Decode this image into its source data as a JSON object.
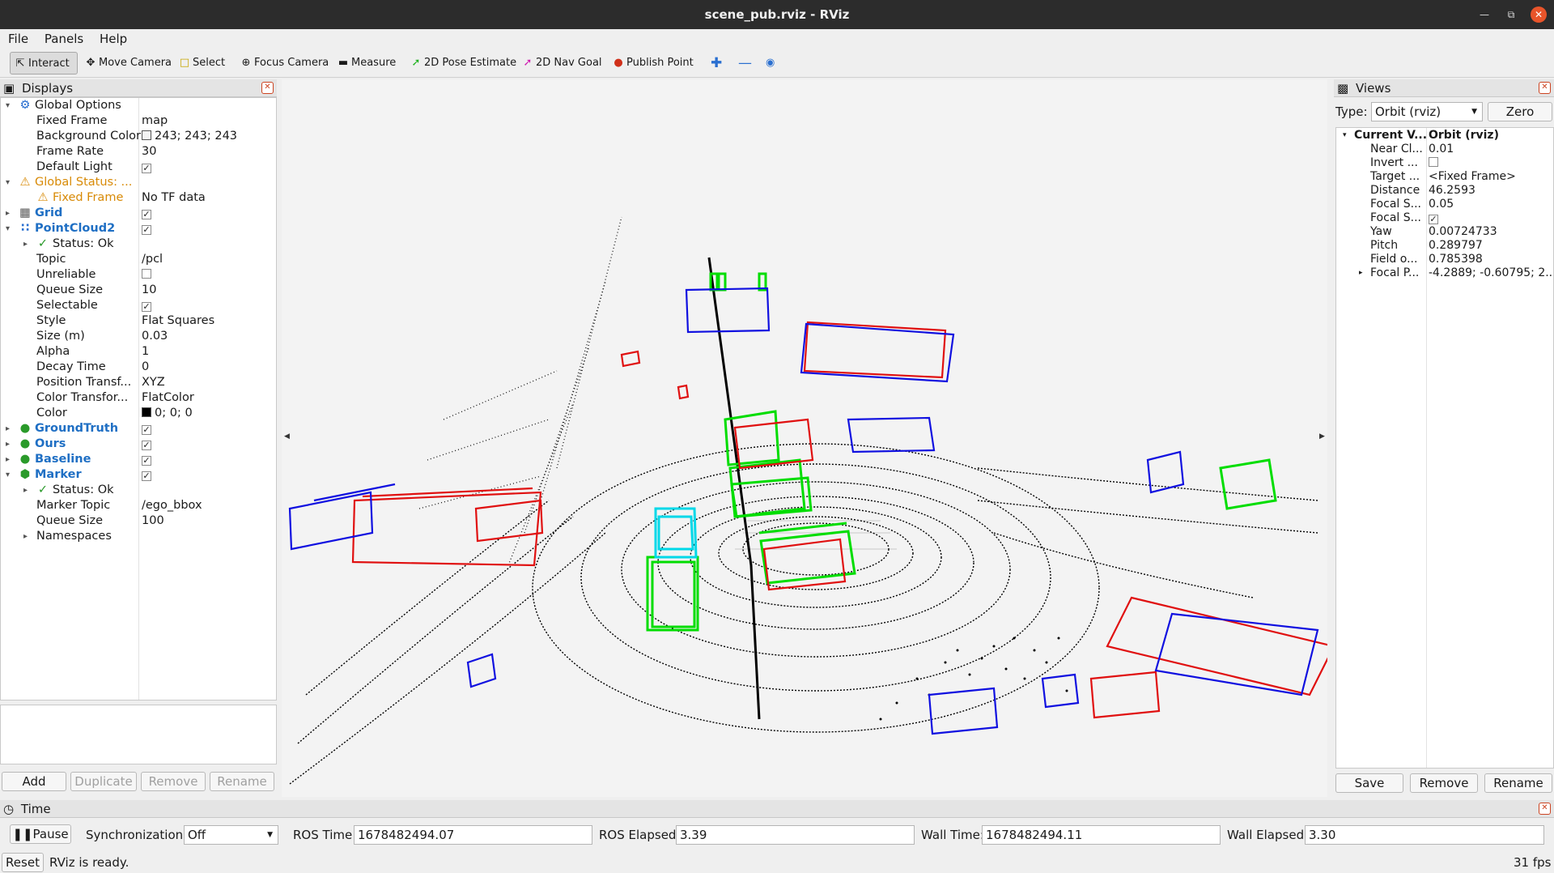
{
  "window": {
    "title": "scene_pub.rviz - RViz"
  },
  "menu": [
    "File",
    "Panels",
    "Help"
  ],
  "toolbar": {
    "interact": "Interact",
    "move_camera": "Move Camera",
    "select": "Select",
    "focus_camera": "Focus Camera",
    "measure": "Measure",
    "pose_estimate": "2D Pose Estimate",
    "nav_goal": "2D Nav Goal",
    "publish_point": "Publish Point"
  },
  "displays": {
    "title": "Displays",
    "rows": [
      {
        "label": "Global Options",
        "value": ""
      },
      {
        "label": "Fixed Frame",
        "value": "map"
      },
      {
        "label": "Background Color",
        "value": "243; 243; 243"
      },
      {
        "label": "Frame Rate",
        "value": "30"
      },
      {
        "label": "Default Light",
        "value": ""
      },
      {
        "label": "Global Status: ...",
        "value": ""
      },
      {
        "label": "Fixed Frame",
        "value": "No TF data"
      },
      {
        "label": "Grid",
        "value": ""
      },
      {
        "label": "PointCloud2",
        "value": ""
      },
      {
        "label": "Status: Ok",
        "value": ""
      },
      {
        "label": "Topic",
        "value": "/pcl"
      },
      {
        "label": "Unreliable",
        "value": ""
      },
      {
        "label": "Queue Size",
        "value": "10"
      },
      {
        "label": "Selectable",
        "value": ""
      },
      {
        "label": "Style",
        "value": "Flat Squares"
      },
      {
        "label": "Size (m)",
        "value": "0.03"
      },
      {
        "label": "Alpha",
        "value": "1"
      },
      {
        "label": "Decay Time",
        "value": "0"
      },
      {
        "label": "Position Transf...",
        "value": "XYZ"
      },
      {
        "label": "Color Transfor...",
        "value": "FlatColor"
      },
      {
        "label": "Color",
        "value": "0; 0; 0"
      },
      {
        "label": "GroundTruth",
        "value": ""
      },
      {
        "label": "Ours",
        "value": ""
      },
      {
        "label": "Baseline",
        "value": ""
      },
      {
        "label": "Marker",
        "value": ""
      },
      {
        "label": "Status: Ok",
        "value": ""
      },
      {
        "label": "Marker Topic",
        "value": "/ego_bbox"
      },
      {
        "label": "Queue Size",
        "value": "100"
      },
      {
        "label": "Namespaces",
        "value": ""
      }
    ],
    "buttons": {
      "add": "Add",
      "duplicate": "Duplicate",
      "remove": "Remove",
      "rename": "Rename"
    }
  },
  "views": {
    "title": "Views",
    "type_label": "Type:",
    "type_value": "Orbit (rviz)",
    "zero": "Zero",
    "rows": [
      {
        "label": "Current V...",
        "value": "Orbit (rviz)"
      },
      {
        "label": "Near Cl...",
        "value": "0.01"
      },
      {
        "label": "Invert ...",
        "value": ""
      },
      {
        "label": "Target ...",
        "value": "<Fixed Frame>"
      },
      {
        "label": "Distance",
        "value": "46.2593"
      },
      {
        "label": "Focal S...",
        "value": "0.05"
      },
      {
        "label": "Focal S...",
        "value": ""
      },
      {
        "label": "Yaw",
        "value": "0.00724733"
      },
      {
        "label": "Pitch",
        "value": "0.289797"
      },
      {
        "label": "Field o...",
        "value": "0.785398"
      },
      {
        "label": "Focal P...",
        "value": "-4.2889; -0.60795; 2...."
      }
    ],
    "buttons": {
      "save": "Save",
      "remove": "Remove",
      "rename": "Rename"
    }
  },
  "time": {
    "title": "Time",
    "pause": "Pause",
    "sync_label": "Synchronization:",
    "sync_value": "Off",
    "ros_time_label": "ROS Time:",
    "ros_time": "1678482494.07",
    "ros_elapsed_label": "ROS Elapsed:",
    "ros_elapsed": "3.39",
    "wall_time_label": "Wall Time:",
    "wall_time": "1678482494.11",
    "wall_elapsed_label": "Wall Elapsed:",
    "wall_elapsed": "3.30"
  },
  "status": {
    "reset": "Reset",
    "message": "RViz is ready.",
    "fps": "31 fps"
  },
  "colors": {
    "ground_truth": "#00dd00",
    "ours": "#e01010",
    "baseline": "#1010e0",
    "ego": "#00d8e8",
    "point_cloud": "#000000",
    "background": "#f3f3f3"
  }
}
